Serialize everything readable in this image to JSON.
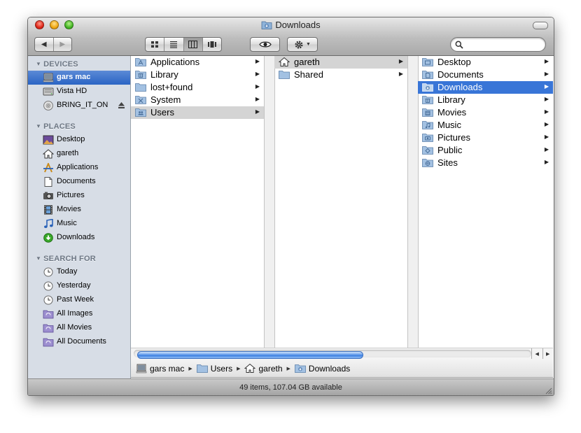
{
  "window": {
    "title": "Downloads"
  },
  "toolbar": {
    "back_icon": "back-arrow-icon",
    "forward_icon": "forward-arrow-icon",
    "view_modes": [
      "icon-view",
      "list-view",
      "column-view",
      "cover-flow-view"
    ],
    "active_view": "column-view",
    "search": {
      "placeholder": "",
      "value": ""
    }
  },
  "sidebar": {
    "devices_header": "DEVICES",
    "devices": [
      {
        "label": "gars mac",
        "icon": "computer-icon",
        "selected": true
      },
      {
        "label": "Vista HD",
        "icon": "hard-drive-icon"
      },
      {
        "label": "BRING_IT_ON",
        "icon": "disc-icon",
        "eject": true
      }
    ],
    "places_header": "PLACES",
    "places": [
      {
        "label": "Desktop",
        "icon": "desktop-icon"
      },
      {
        "label": "gareth",
        "icon": "home-icon"
      },
      {
        "label": "Applications",
        "icon": "applications-icon"
      },
      {
        "label": "Documents",
        "icon": "documents-icon"
      },
      {
        "label": "Pictures",
        "icon": "camera-icon"
      },
      {
        "label": "Movies",
        "icon": "film-icon"
      },
      {
        "label": "Music",
        "icon": "music-note-icon"
      },
      {
        "label": "Downloads",
        "icon": "download-icon"
      }
    ],
    "search_header": "SEARCH FOR",
    "search_for": [
      {
        "label": "Today",
        "icon": "clock-icon"
      },
      {
        "label": "Yesterday",
        "icon": "clock-icon"
      },
      {
        "label": "Past Week",
        "icon": "clock-icon"
      },
      {
        "label": "All Images",
        "icon": "smart-folder-icon"
      },
      {
        "label": "All Movies",
        "icon": "smart-folder-icon"
      },
      {
        "label": "All Documents",
        "icon": "smart-folder-icon"
      }
    ]
  },
  "columns": [
    {
      "items": [
        {
          "label": "Applications",
          "icon": "applications-folder-icon"
        },
        {
          "label": "Library",
          "icon": "library-folder-icon"
        },
        {
          "label": "lost+found",
          "icon": "folder-icon"
        },
        {
          "label": "System",
          "icon": "system-folder-icon"
        },
        {
          "label": "Users",
          "icon": "users-folder-icon",
          "selected": "gray"
        }
      ]
    },
    {
      "items": [
        {
          "label": "gareth",
          "icon": "home-icon",
          "selected": "gray"
        },
        {
          "label": "Shared",
          "icon": "folder-icon"
        }
      ]
    },
    {
      "items": [
        {
          "label": "Desktop",
          "icon": "desktop-folder-icon"
        },
        {
          "label": "Documents",
          "icon": "documents-folder-icon"
        },
        {
          "label": "Downloads",
          "icon": "downloads-folder-icon",
          "selected": "blue"
        },
        {
          "label": "Library",
          "icon": "library-folder-icon"
        },
        {
          "label": "Movies",
          "icon": "movies-folder-icon"
        },
        {
          "label": "Music",
          "icon": "music-folder-icon"
        },
        {
          "label": "Pictures",
          "icon": "pictures-folder-icon"
        },
        {
          "label": "Public",
          "icon": "public-folder-icon"
        },
        {
          "label": "Sites",
          "icon": "sites-folder-icon"
        }
      ]
    }
  ],
  "scrollbar": {
    "thumb_fraction": 0.72
  },
  "pathbar": [
    {
      "label": "gars mac",
      "icon": "computer-icon"
    },
    {
      "label": "Users",
      "icon": "folder-icon"
    },
    {
      "label": "gareth",
      "icon": "home-icon"
    },
    {
      "label": "Downloads",
      "icon": "downloads-folder-icon"
    }
  ],
  "status": {
    "text": "49 items, 107.04 GB available"
  },
  "colors": {
    "selection_blue": "#3875d7",
    "sidebar_bg": "#d7dde6",
    "selection_gray": "#d4d4d4"
  }
}
